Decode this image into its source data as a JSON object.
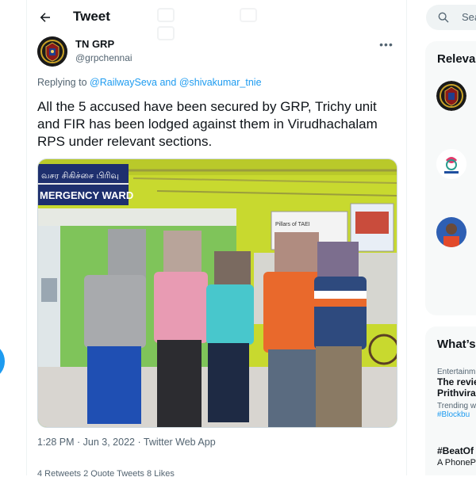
{
  "header": {
    "back_icon": "arrow-left-icon",
    "title": "Tweet"
  },
  "tweet": {
    "author_name": "TN GRP",
    "author_handle": "@grpchennai",
    "replying_prefix": "Replying to",
    "reply_mention_1": "@RailwaySeva",
    "reply_conjunction": "and",
    "reply_mention_2": "@shivakumar_tnie",
    "text": "All the 5 accused have been secured by GRP, Trichy unit and FIR has been lodged against them in Virudhachalam RPS under relevant sections.",
    "photo": {
      "sign_tamil": "வசர சிகிச்சை பிரிவு",
      "sign_english": "MERGENCY WARD",
      "poster_text": "Pillars of TAEI"
    },
    "timestamp": "1:28 PM · Jun 3, 2022 · Twitter Web App",
    "stats": "4 Retweets   2 Quote Tweets   8 Likes"
  },
  "sidebar": {
    "search_placeholder": "Search Twitter",
    "search_display": "Sea",
    "relevant_title": "Releva",
    "whats_title": "What’s",
    "trend1_category": "Entertainm",
    "trend1_title_l1": "The revie",
    "trend1_title_l2": "Prithvira",
    "trend1_sub": "Trending w",
    "trend1_tag": "#Blockbu",
    "trend2_title": "#BeatOf",
    "trend2_sub": "A PhoneP"
  },
  "colors": {
    "accent": "#1d9bf0",
    "text_primary": "#0f1419",
    "text_secondary": "#536471",
    "panel_bg": "#f7f9f9",
    "wall_green": "#c8d92f"
  }
}
